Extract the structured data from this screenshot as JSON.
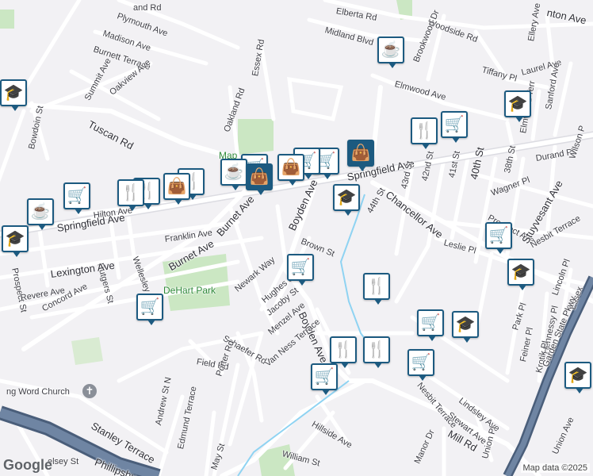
{
  "map": {
    "streets": {
      "elberta_rd": "Elberta Rd",
      "woodside_rd": "Woodside Rd",
      "midland_blvd": "Midland Blvd",
      "plymouth_ave": "Plymouth Ave",
      "madison_ave": "Madison Ave",
      "burnett_terrace": "Burnett Terrace",
      "essex_rd": "Essex Rd",
      "brookwood_dr": "Brookwood Dr",
      "ellery_ave": "Ellery Ave",
      "laurel_ave": "Laurel Ave",
      "tiffany_pl": "Tiffany Pl",
      "elmwood_ave": "Elmwood Ave",
      "summit_ave": "Summit Ave",
      "oakview_ave": "Oakview Ave",
      "sanford_ave": "Sanford Ave",
      "elmwood_terr": "Elmwood Terr",
      "tuscan_rd": "Tuscan Rd",
      "oakland_rd": "Oakland Rd",
      "bowdoin_st": "Bowdoin St",
      "springfield_ave_east": "Springfield Ave",
      "springfield_ave_west": "Springfield Ave",
      "durand_pl": "Durand Pl",
      "wilson_pl": "Wilson P",
      "38th_st": "38th St",
      "43rd_st": "43rd St",
      "42nd_st": "42nd St",
      "41st_st": "41st St",
      "40th_st": "40th St",
      "wagner_pl": "Wagner Pl",
      "chancellor_ave": "Chancellor Ave",
      "44th_st": "44th St",
      "prospect_ave": "Prospect Ave",
      "stuyvesant_ave": "Stuyvesant Ave",
      "boyden_ave_north": "Boyden Ave",
      "boyden_ave_south": "Boyden Ave",
      "burnet_ave_north": "Burnet Ave",
      "burnet_ave_south": "Burnet Ave",
      "hilton_ave": "Hilton Ave",
      "franklin_ave": "Franklin Ave",
      "wellesley_st": "Wellesley St",
      "rutgers_st": "Rutgers St",
      "prospect_st": "Prospect St",
      "lexington_ave": "Lexington Ave",
      "brown_st": "Brown St",
      "leslie_pl": "Leslie Pl",
      "nesbit_terrace": "Nesbit Terrace",
      "lincoln_pl": "Lincoln Pl",
      "newark_way": "Newark Way",
      "hughes_st": "Hughes St",
      "revere_ave": "Revere Ave",
      "concord_ave": "Concord Ave",
      "jacoby_st": "Jacoby St",
      "menzel_ave": "Menzel Ave",
      "park_pl": "Park Pl",
      "essex_cut": "Essex",
      "schaefer_rd": "Schaefer Rd",
      "van_ness_terrace": "Van Ness Terrace",
      "hennessy_pl": "Hennessy Pl",
      "feiner_pl": "Feiner Pl",
      "krotik_pl": "Krotik Pl",
      "field_rd": "Field Rd",
      "porter_rd": "Porter Rd",
      "garden_state_pkwy": "Garden State Pkwy",
      "nesbit_terrace_2": "Nesbit Terrace",
      "lindsley_ave": "Lindsley Ave",
      "stewart_ave": "Stewart Ave",
      "andrew_st": "Andrew St N",
      "stanley_terrace": "Stanley Terrace",
      "edmund_terrace": "Edmund Terrace",
      "hillside_ave": "Hillside Ave",
      "mill_rd": "Mill Rd",
      "union_pl": "Union Pl",
      "union_ave": "Union Ave",
      "manor_dr": "Manor Dr",
      "william_st": "William St",
      "may_st": "May St",
      "phillipsburg": "Phillipsbu",
      "kelsey_st": "elsey St",
      "fanton_ave": "nton Ave",
      "top_rd": "and Rd"
    },
    "places": {
      "dehart_park": "DeHart Park",
      "map_cut": "Map",
      "church": "ng Word Church"
    },
    "icons": {
      "grocery": "grocery-cart-icon",
      "restaurant": "restaurant-icon",
      "cafe": "cafe-icon",
      "school": "school-icon",
      "shopping": "shopping-bag-icon"
    },
    "footer": {
      "google": "Google",
      "credit": "Map data ©2025"
    },
    "colors": {
      "road": "#ffffff",
      "major_road": "#dcdce2",
      "highway": "#4a5e7a",
      "water": "#8fd3f2",
      "park": "#cbe7c3",
      "pin": "#1c5a80"
    }
  }
}
